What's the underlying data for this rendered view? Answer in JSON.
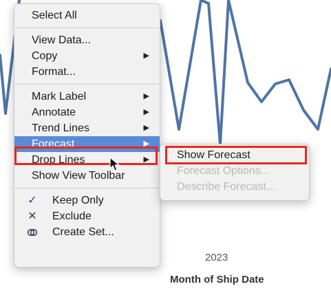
{
  "chart": {
    "line_color": "#4f74a6",
    "x_tick_label": "2023",
    "x_axis_title": "Month of Ship Date"
  },
  "context_menu": {
    "select_all": "Select All",
    "view_data": "View Data...",
    "copy": "Copy",
    "format": "Format...",
    "mark_label": "Mark Label",
    "annotate": "Annotate",
    "trend_lines": "Trend Lines",
    "forecast": "Forecast",
    "drop_lines": "Drop Lines",
    "show_view_toolbar": "Show View Toolbar",
    "keep_only": "Keep Only",
    "exclude": "Exclude",
    "create_set": "Create Set...",
    "highlight_color": "#5b8bd6",
    "icons": {
      "submenu_arrow": "triangle-right-icon",
      "keep_only": "checkmark-icon",
      "exclude": "x-icon",
      "create_set": "venn-icon"
    }
  },
  "forecast_submenu": {
    "show_forecast": "Show Forecast",
    "forecast_options": "Forecast Options...",
    "describe_forecast": "Describe Forecast..."
  },
  "annotation": {
    "outline_color": "#e8271c"
  }
}
